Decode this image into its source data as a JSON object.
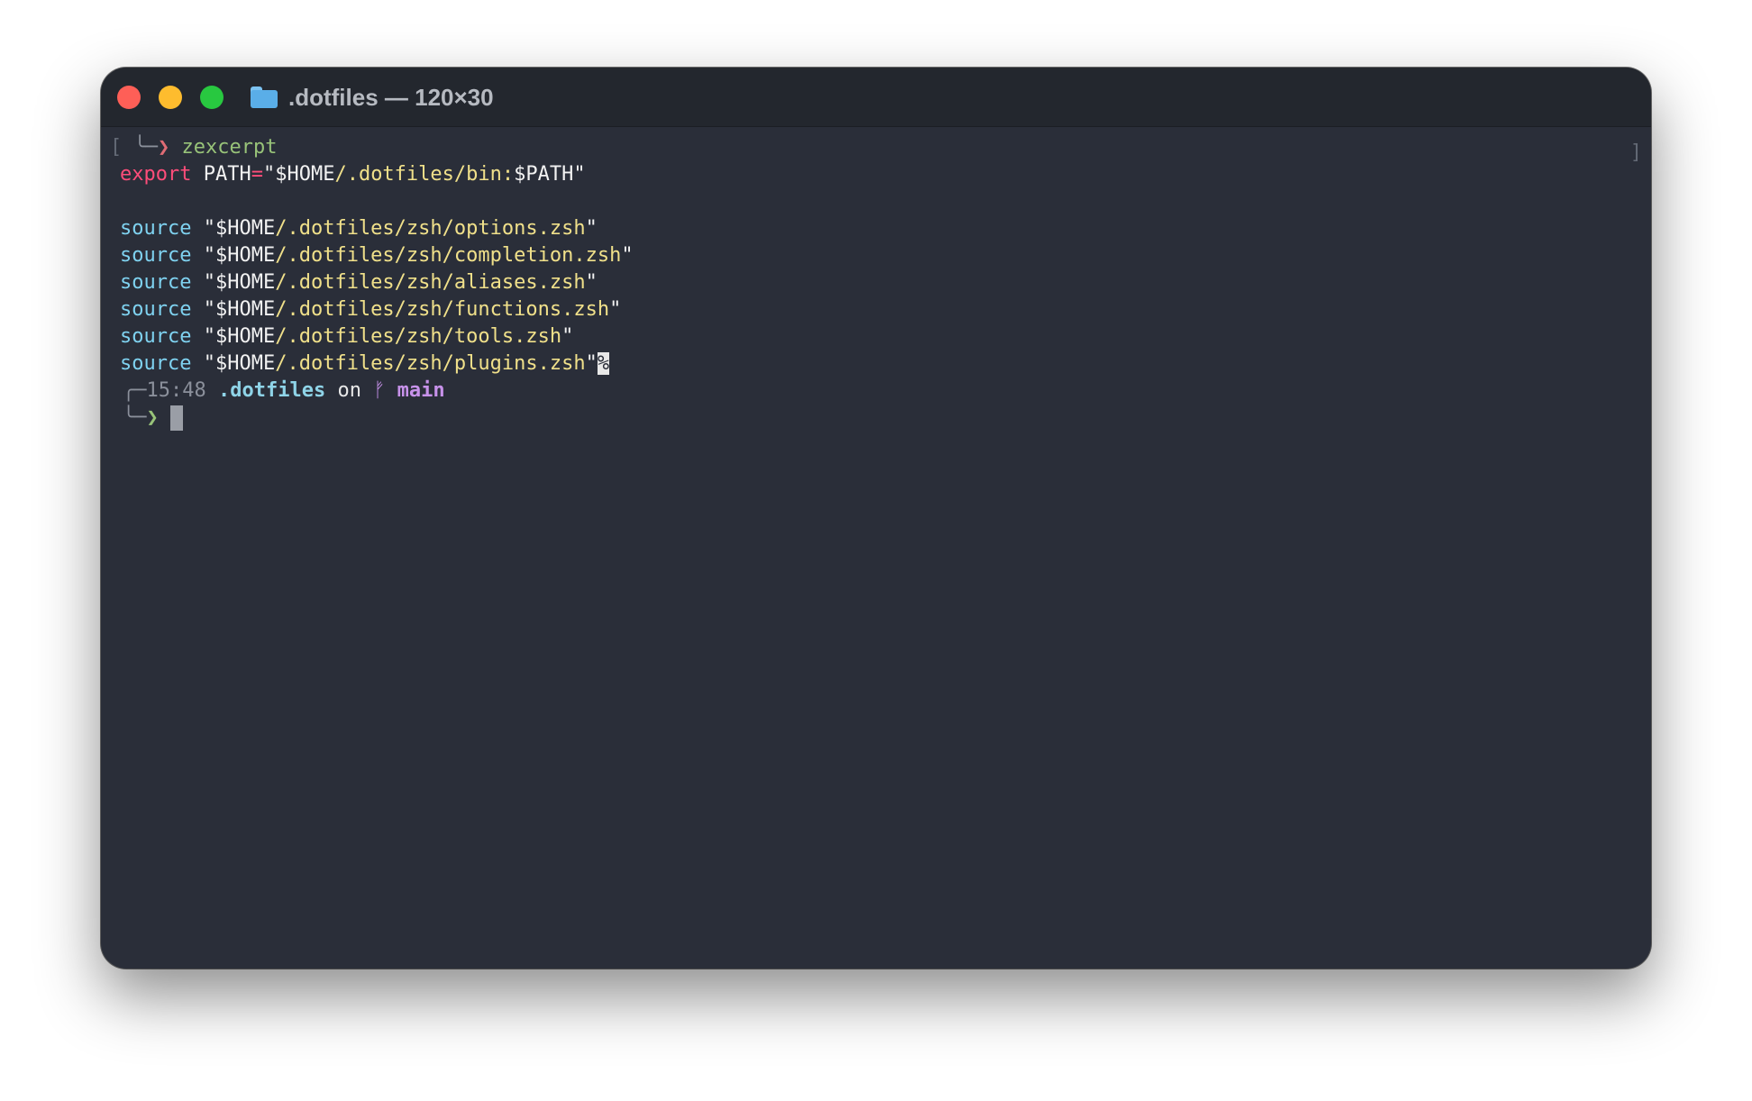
{
  "window": {
    "title": ".dotfiles — 120×30",
    "folder_icon": "folder-icon"
  },
  "terminal": {
    "prev_prompt": {
      "open_bracket": "[",
      "hook": "╰─",
      "arrow": "❯",
      "command": "zexcerpt",
      "close_bracket": "]"
    },
    "export_line": {
      "keyword": "export",
      "var": "PATH",
      "eq": "=",
      "q1": "\"",
      "home": "$HOME",
      "path": "/.dotfiles/bin:",
      "pathvar": "$PATH",
      "q2": "\""
    },
    "source_lines": [
      {
        "keyword": "source",
        "q1": "\"",
        "home": "$HOME",
        "path": "/.dotfiles/zsh/options.zsh",
        "q2": "\""
      },
      {
        "keyword": "source",
        "q1": "\"",
        "home": "$HOME",
        "path": "/.dotfiles/zsh/completion.zsh",
        "q2": "\""
      },
      {
        "keyword": "source",
        "q1": "\"",
        "home": "$HOME",
        "path": "/.dotfiles/zsh/aliases.zsh",
        "q2": "\""
      },
      {
        "keyword": "source",
        "q1": "\"",
        "home": "$HOME",
        "path": "/.dotfiles/zsh/functions.zsh",
        "q2": "\""
      },
      {
        "keyword": "source",
        "q1": "\"",
        "home": "$HOME",
        "path": "/.dotfiles/zsh/tools.zsh",
        "q2": "\""
      },
      {
        "keyword": "source",
        "q1": "\"",
        "home": "$HOME",
        "path": "/.dotfiles/zsh/plugins.zsh",
        "q2": "\"",
        "eol": "%"
      }
    ],
    "current_prompt": {
      "corner_top": "╭─",
      "time": "15:48",
      "dir": ".dotfiles",
      "on": "on",
      "branch_icon": "ᚠ",
      "branch": "main",
      "corner_bottom": "╰─",
      "arrow": "❯"
    }
  },
  "colors": {
    "red_light": "#fe5f57",
    "yellow_light": "#febc2e",
    "green_light": "#28c840",
    "background": "#2a2e39"
  }
}
